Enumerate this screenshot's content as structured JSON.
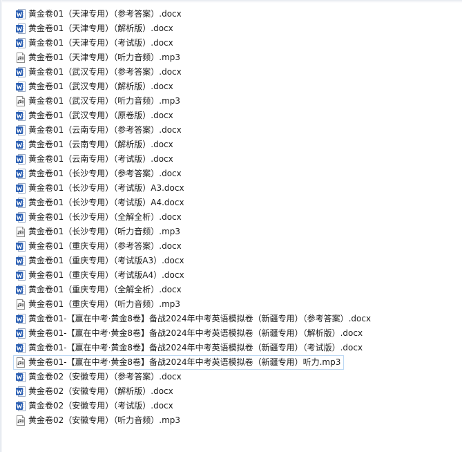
{
  "explorer": {
    "colors": {
      "word_icon": "#2b5fb3",
      "audio_icon": "#5a5a5a",
      "selection_border": "#bcd8f4"
    },
    "files": [
      {
        "name": "黄金卷01（天津专用）（参考答案）.docx",
        "icon": "word-doc-icon"
      },
      {
        "name": "黄金卷01（天津专用）（解析版）.docx",
        "icon": "word-doc-icon"
      },
      {
        "name": "黄金卷01（天津专用）（考试版）.docx",
        "icon": "word-doc-icon"
      },
      {
        "name": "黄金卷01（天津专用）（听力音频）.mp3",
        "icon": "audio-file-icon"
      },
      {
        "name": "黄金卷01（武汉专用）（参考答案）.docx",
        "icon": "word-doc-icon"
      },
      {
        "name": "黄金卷01（武汉专用）（解析版）.docx",
        "icon": "word-doc-icon"
      },
      {
        "name": "黄金卷01（武汉专用）（听力音频）.mp3",
        "icon": "audio-file-icon"
      },
      {
        "name": "黄金卷01（武汉专用）（原卷版）.docx",
        "icon": "word-doc-icon"
      },
      {
        "name": "黄金卷01（云南专用）（参考答案）.docx",
        "icon": "word-doc-icon"
      },
      {
        "name": "黄金卷01（云南专用）（解析版）.docx",
        "icon": "word-doc-icon"
      },
      {
        "name": "黄金卷01（云南专用）（考试版）.docx",
        "icon": "word-doc-icon"
      },
      {
        "name": "黄金卷01（长沙专用）（参考答案）.docx",
        "icon": "word-doc-icon"
      },
      {
        "name": "黄金卷01（长沙专用）（考试版）A3.docx",
        "icon": "word-doc-icon"
      },
      {
        "name": "黄金卷01（长沙专用）（考试版）A4.docx",
        "icon": "word-doc-icon"
      },
      {
        "name": "黄金卷01（长沙专用）（全解全析）.docx",
        "icon": "word-doc-icon"
      },
      {
        "name": "黄金卷01（长沙专用）（听力音频）.mp3",
        "icon": "audio-file-icon"
      },
      {
        "name": "黄金卷01（重庆专用）（参考答案）.docx",
        "icon": "word-doc-icon"
      },
      {
        "name": "黄金卷01（重庆专用）（考试版A3）.docx",
        "icon": "word-doc-icon"
      },
      {
        "name": "黄金卷01（重庆专用）（考试版A4）.docx",
        "icon": "word-doc-icon"
      },
      {
        "name": "黄金卷01（重庆专用）（全解全析）.docx",
        "icon": "word-doc-icon"
      },
      {
        "name": "黄金卷01（重庆专用）（听力音频）.mp3",
        "icon": "audio-file-icon"
      },
      {
        "name": "黄金卷01-【赢在中考·黄金8卷】备战2024年中考英语模拟卷（新疆专用）（参考答案）.docx",
        "icon": "word-doc-icon"
      },
      {
        "name": "黄金卷01-【赢在中考·黄金8卷】备战2024年中考英语模拟卷（新疆专用）（解析版）.docx",
        "icon": "word-doc-icon"
      },
      {
        "name": "黄金卷01-【赢在中考·黄金8卷】备战2024年中考英语模拟卷（新疆专用）（考试版）.docx",
        "icon": "word-doc-icon"
      },
      {
        "name": "黄金卷01-【赢在中考·黄金8卷】备战2024年中考英语模拟卷（新疆专用）听力.mp3",
        "icon": "audio-file-icon",
        "selected": true
      },
      {
        "name": "黄金卷02（安徽专用）（参考答案）.docx",
        "icon": "word-doc-icon"
      },
      {
        "name": "黄金卷02（安徽专用）（解析版）.docx",
        "icon": "word-doc-icon"
      },
      {
        "name": "黄金卷02（安徽专用）（考试版）.docx",
        "icon": "word-doc-icon"
      },
      {
        "name": "黄金卷02（安徽专用）（听力音频）.mp3",
        "icon": "audio-file-icon"
      }
    ]
  }
}
